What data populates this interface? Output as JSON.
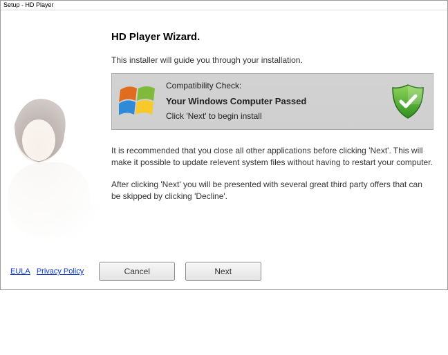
{
  "titlebar": "Setup - HD Player",
  "heading": "HD Player Wizard.",
  "intro": "This installer will guide you through your installation.",
  "compat": {
    "line1": "Compatibility Check:",
    "line2": "Your Windows Computer Passed",
    "line3": "Click 'Next' to begin install"
  },
  "recommend": "It is recommended that you close all other applications before clicking 'Next'. This will make it possible to update relevent system files without having to restart your computer.",
  "offers": "After clicking 'Next' you will be presented with several great third party offers that can be skipped by clicking 'Decline'.",
  "links": {
    "eula": "EULA",
    "privacy": "Privacy Policy"
  },
  "buttons": {
    "cancel": "Cancel",
    "next": "Next"
  }
}
